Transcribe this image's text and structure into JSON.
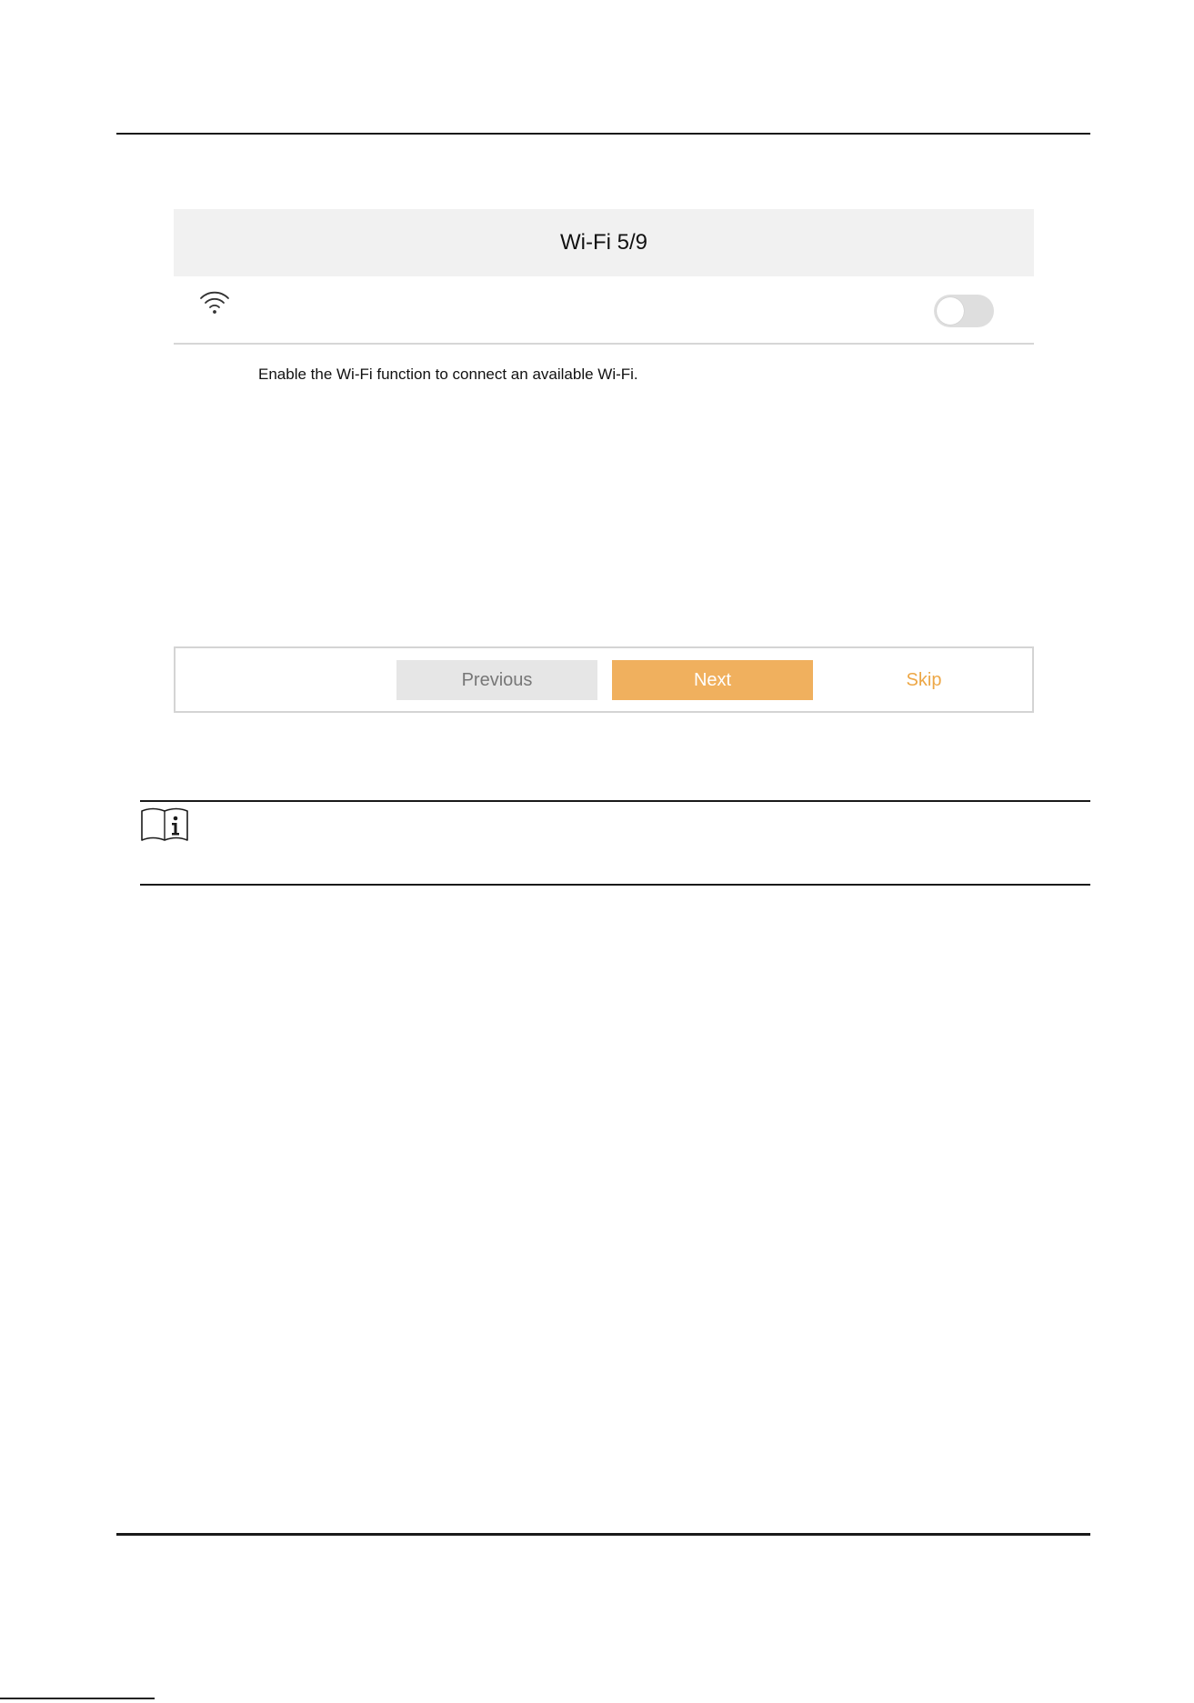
{
  "figure": {
    "title": "Wi-Fi 5/9",
    "wifi_toggle": {
      "icon": "wifi-icon",
      "state": "off"
    },
    "hint": "Enable the Wi-Fi function to connect an available Wi-Fi.",
    "buttons": {
      "previous": "Previous",
      "next": "Next",
      "skip": "Skip"
    }
  },
  "note": {
    "icon": "note-book-icon"
  },
  "colors": {
    "accent": "#f0b05e",
    "skip_text": "#eda746",
    "title_bar_bg": "#f1f1f1",
    "previous_bg": "#e6e6e6",
    "toggle_off": "#dedede"
  }
}
